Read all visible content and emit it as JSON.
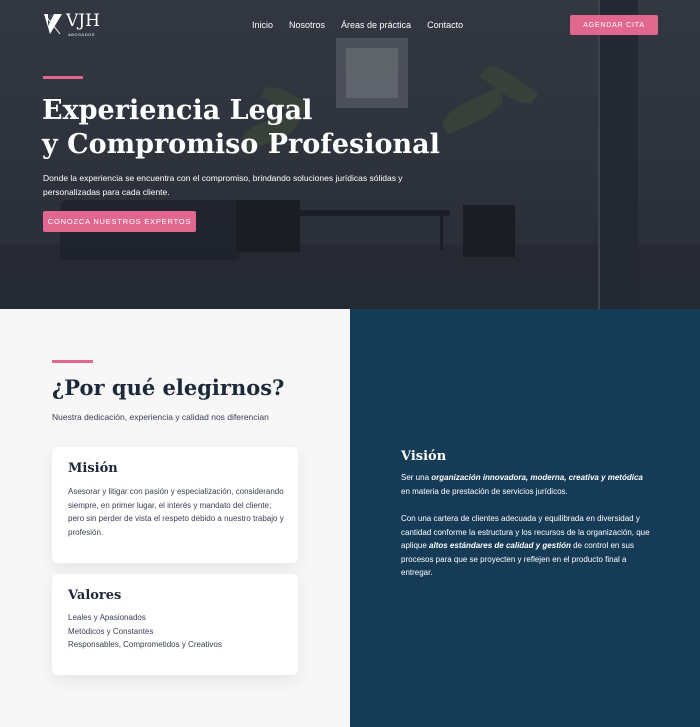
{
  "brand": {
    "logo_text": "VJH",
    "logo_subtext": "ABOGADOS"
  },
  "nav": {
    "items": [
      "Inicio",
      "Nosotros",
      "Áreas de práctica",
      "Contacto"
    ],
    "cta": "AGENDAR CITA"
  },
  "hero": {
    "title_line1": "Experiencia Legal",
    "title_line2": "y Compromiso Profesional",
    "description": "Donde la experiencia se encuentra con el compromiso, brindando soluciones jurídicas sólidas y personalizadas para cada cliente.",
    "button": "CONOZCA NUESTROS EXPERTOS"
  },
  "why": {
    "title": "¿Por qué elegirnos?",
    "subtitle": "Nuestra dedicación, experiencia y calidad nos diferencian"
  },
  "mision": {
    "title": "Misión",
    "text": "Asesorar y litigar con pasión y especialización, considerando siempre, en primer lugar, el interés y mandato del cliente; pero sin perder de vista el respeto debido a nuestro trabajo y profesión."
  },
  "valores": {
    "title": "Valores",
    "items": [
      "Leales y Apasionados",
      "Metódicos y Constantes",
      "Responsables, Comprometidos y Creativos"
    ]
  },
  "vision": {
    "title": "Visión",
    "p1_a": "Ser una ",
    "p1_b": "organización innovadora, moderna, creativa y metódica",
    "p1_c": " en materia de prestación de servicios jurídicos.",
    "p2_a": "Con una cartera de clientes adecuada y equilibrada en diversidad y cantidad conforme la estructura y los recursos de la organización, que aplique ",
    "p2_b": "altos estándares de calidad y gestión",
    "p2_c": " de control en sus procesos para que se proyecten y reflejen en el producto final a entregar."
  },
  "colors": {
    "accent": "#e1678f",
    "navy": "#163b57",
    "text_dark": "#1d2838"
  }
}
